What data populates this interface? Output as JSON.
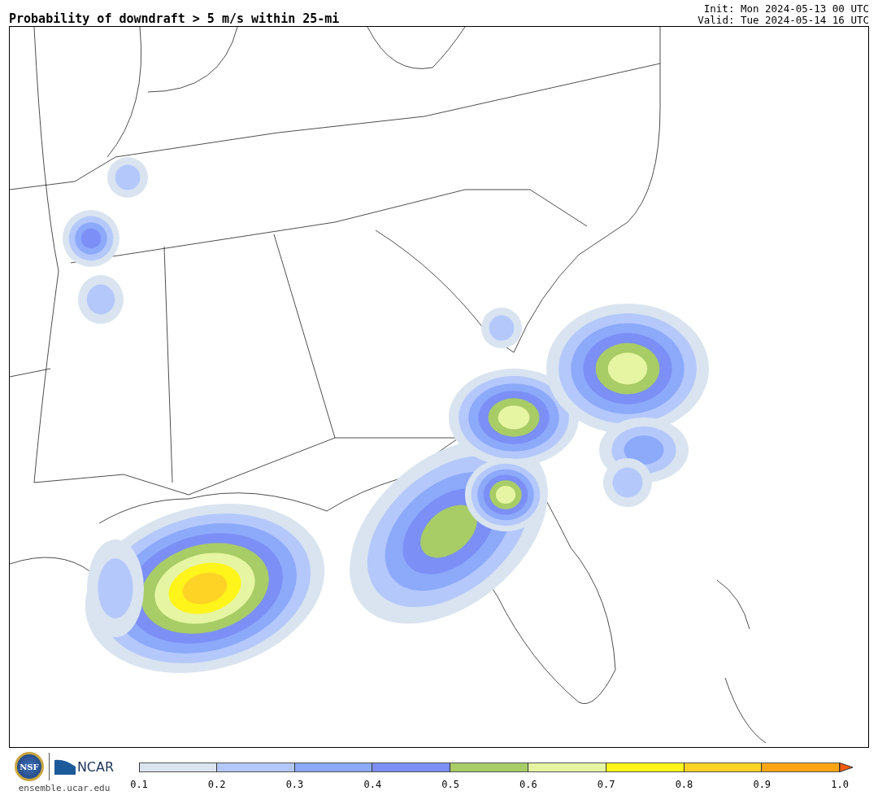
{
  "header": {
    "title": "Probability of downdraft > 5 m/s within 25-mi",
    "init": "Init: Mon 2024-05-13 00 UTC",
    "valid": "Valid: Tue 2024-05-14 16 UTC"
  },
  "footer": {
    "nsf_logo": "NSF",
    "ncar_logo": "NCAR",
    "site": "ensemble.ucar.edu"
  },
  "colorbar": {
    "segments": [
      {
        "color": "#d9e4f0"
      },
      {
        "color": "#b4c8fb"
      },
      {
        "color": "#8ca9fa"
      },
      {
        "color": "#7b8ff6"
      },
      {
        "color": "#a8cc66"
      },
      {
        "color": "#e6f5a2"
      },
      {
        "color": "#fff51a"
      },
      {
        "color": "#ffd226"
      },
      {
        "color": "#ffa514"
      },
      {
        "kind": "arrow",
        "color": "#f25b0a"
      }
    ],
    "ticks": [
      "0.1",
      "0.2",
      "0.3",
      "0.4",
      "0.5",
      "0.6",
      "0.7",
      "0.8",
      "0.9",
      "1.0"
    ]
  }
}
